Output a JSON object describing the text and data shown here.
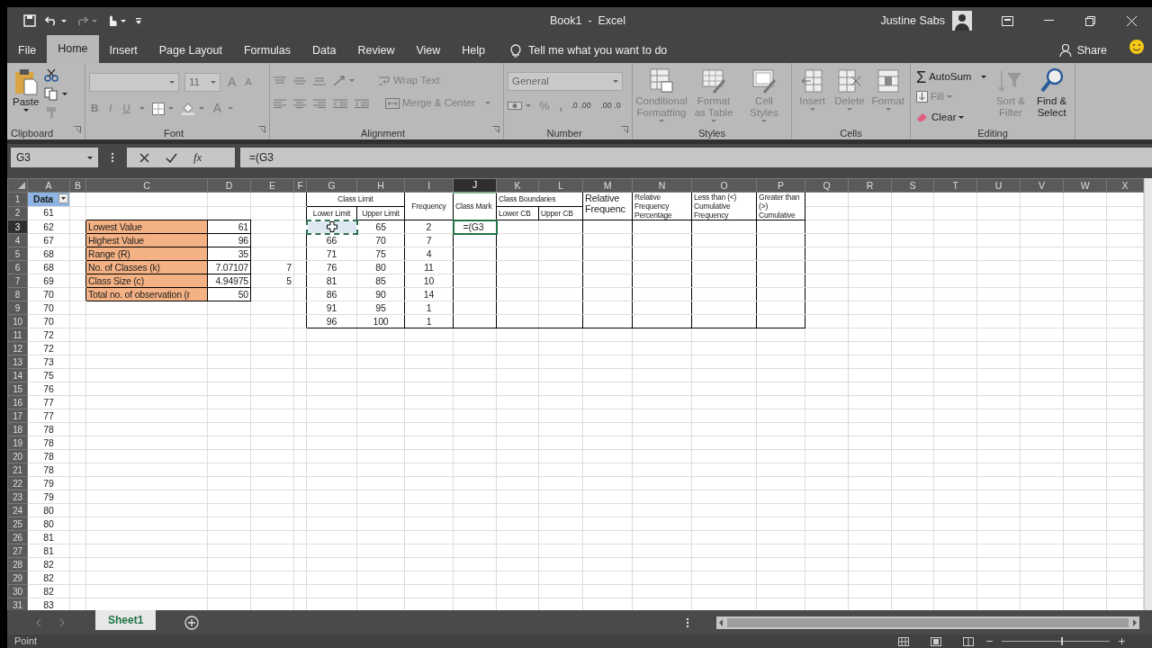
{
  "title_bar": {
    "title": "Book1  -  Excel",
    "user": "Justine Sabs"
  },
  "menu_tabs": [
    {
      "label": "File",
      "selected": false
    },
    {
      "label": "Home",
      "selected": true
    },
    {
      "label": "Insert",
      "selected": false
    },
    {
      "label": "Page Layout",
      "selected": false
    },
    {
      "label": "Formulas",
      "selected": false
    },
    {
      "label": "Data",
      "selected": false
    },
    {
      "label": "Review",
      "selected": false
    },
    {
      "label": "View",
      "selected": false
    },
    {
      "label": "Help",
      "selected": false
    }
  ],
  "tell_me": "Tell me what you want to do",
  "share": "Share",
  "ribbon": {
    "clipboard": {
      "label": "Clipboard",
      "paste": "Paste"
    },
    "font": {
      "label": "Font",
      "font_size": "11",
      "grow": "A",
      "shrink": "A",
      "bold": "B",
      "italic": "I",
      "underline": "U",
      "font_color_letter": "A"
    },
    "alignment": {
      "label": "Alignment",
      "wrap_text": {
        "label": "Wrap Text",
        "disabled": true
      },
      "merge_center": {
        "label": "Merge & Center",
        "disabled": true
      }
    },
    "number": {
      "label": "Number",
      "format": "General",
      "percent": "%",
      "comma": ",",
      "increase_decimal": ".0 .00",
      "decrease_decimal": ".00 .0"
    },
    "styles": {
      "label": "Styles",
      "buttons": [
        {
          "label": "Conditional Formatting",
          "disabled": true
        },
        {
          "label": "Format as Table",
          "disabled": true
        },
        {
          "label": "Cell Styles",
          "disabled": true
        }
      ]
    },
    "cells": {
      "label": "Cells",
      "buttons": [
        {
          "label": "Insert",
          "disabled": true
        },
        {
          "label": "Delete",
          "disabled": true
        },
        {
          "label": "Format",
          "disabled": true
        }
      ]
    },
    "editing": {
      "label": "Editing",
      "autosum": {
        "symbol": "Σ",
        "label": "AutoSum",
        "disabled": false
      },
      "fill": {
        "label": "Fill",
        "disabled": true
      },
      "clear": {
        "label": "Clear",
        "disabled": false
      },
      "sort_filter": {
        "label": "Sort & Filter",
        "disabled": true
      },
      "find_select": {
        "label": "Find & Select",
        "disabled": false
      }
    }
  },
  "formula_bar": {
    "name_box": "G3",
    "insert_function": "fx",
    "formula": "=(G3"
  },
  "columns": [
    {
      "letter": "A",
      "selected": false
    },
    {
      "letter": "B",
      "selected": false
    },
    {
      "letter": "C",
      "selected": false
    },
    {
      "letter": "D",
      "selected": false
    },
    {
      "letter": "E",
      "selected": false
    },
    {
      "letter": "F",
      "selected": false
    },
    {
      "letter": "G",
      "selected": false
    },
    {
      "letter": "H",
      "selected": false
    },
    {
      "letter": "I",
      "selected": false
    },
    {
      "letter": "J",
      "selected": true
    },
    {
      "letter": "K",
      "selected": false
    },
    {
      "letter": "L",
      "selected": false
    },
    {
      "letter": "M",
      "selected": false
    },
    {
      "letter": "N",
      "selected": false
    },
    {
      "letter": "O",
      "selected": false
    },
    {
      "letter": "P",
      "selected": false
    },
    {
      "letter": "Q",
      "selected": false
    },
    {
      "letter": "R",
      "selected": false
    },
    {
      "letter": "S",
      "selected": false
    },
    {
      "letter": "T",
      "selected": false
    },
    {
      "letter": "U",
      "selected": false
    },
    {
      "letter": "V",
      "selected": false
    },
    {
      "letter": "W",
      "selected": false
    },
    {
      "letter": "X",
      "selected": false
    }
  ],
  "rows": [
    {
      "number": "1",
      "selected": false,
      "cells": {
        "A": {
          "text": "Data",
          "kind": "filter"
        },
        "G": {
          "text": "Class Limit",
          "kind": "header"
        },
        "I": {
          "text": "Frequency",
          "kind": "header"
        },
        "J": {
          "text": "Class Mark",
          "kind": "header"
        },
        "K": {
          "text": "Class Boundaries",
          "kind": "header"
        },
        "M": {
          "text": "Relative Frequenc",
          "kind": "header_large"
        },
        "N": {
          "text": "Relative Frequency Percentage",
          "kind": "header"
        },
        "O": {
          "text": "Less than (<) Cumulative Frequency",
          "kind": "header"
        },
        "P": {
          "text": "Greater than (>) Cumulative",
          "kind": "header"
        }
      }
    },
    {
      "number": "2",
      "selected": false,
      "cells": {
        "A": "61",
        "G": {
          "text": "Lower Limit",
          "kind": "header"
        },
        "H": {
          "text": "Upper Limit",
          "kind": "header"
        },
        "K": {
          "text": "Lower CB",
          "kind": "header"
        },
        "L": {
          "text": "Upper CB",
          "kind": "header"
        }
      }
    },
    {
      "number": "3",
      "selected": true,
      "cells": {
        "A": "62",
        "C": {
          "text": "Lowest Value",
          "kind": "label"
        },
        "D": "61",
        "G": {
          "kind": "reference"
        },
        "H": "65",
        "I": "2",
        "J": {
          "text": "=(G3",
          "kind": "editing"
        }
      }
    },
    {
      "number": "4",
      "selected": false,
      "cells": {
        "A": "67",
        "C": {
          "text": "Highest Value",
          "kind": "label"
        },
        "D": "96",
        "G": "66",
        "H": "70",
        "I": "7"
      }
    },
    {
      "number": "5",
      "selected": false,
      "cells": {
        "A": "68",
        "C": {
          "text": "Range (R)",
          "kind": "label"
        },
        "D": "35",
        "G": "71",
        "H": "75",
        "I": "4"
      }
    },
    {
      "number": "6",
      "selected": false,
      "cells": {
        "A": "68",
        "C": {
          "text": "No. of Classes (k)",
          "kind": "label"
        },
        "D": "7.07107",
        "E": "7",
        "G": "76",
        "H": "80",
        "I": "11"
      }
    },
    {
      "number": "7",
      "selected": false,
      "cells": {
        "A": "69",
        "C": {
          "text": "Class Size (c)",
          "kind": "label"
        },
        "D": "4.94975",
        "E": "5",
        "G": "81",
        "H": "85",
        "I": "10"
      }
    },
    {
      "number": "8",
      "selected": false,
      "cells": {
        "A": "70",
        "C": {
          "text": "Total no. of observation (r",
          "kind": "label"
        },
        "D": "50",
        "G": "86",
        "H": "90",
        "I": "14"
      }
    },
    {
      "number": "9",
      "selected": false,
      "cells": {
        "A": "70",
        "G": "91",
        "H": "95",
        "I": "1"
      }
    },
    {
      "number": "10",
      "selected": false,
      "cells": {
        "A": "70",
        "G": "96",
        "H": "100",
        "I": "1"
      }
    },
    {
      "number": "11",
      "selected": false,
      "cells": {
        "A": "72"
      }
    },
    {
      "number": "12",
      "selected": false,
      "cells": {
        "A": "72"
      }
    },
    {
      "number": "13",
      "selected": false,
      "cells": {
        "A": "73"
      }
    },
    {
      "number": "14",
      "selected": false,
      "cells": {
        "A": "75"
      }
    },
    {
      "number": "15",
      "selected": false,
      "cells": {
        "A": "76"
      }
    },
    {
      "number": "16",
      "selected": false,
      "cells": {
        "A": "77"
      }
    },
    {
      "number": "17",
      "selected": false,
      "cells": {
        "A": "77"
      }
    },
    {
      "number": "18",
      "selected": false,
      "cells": {
        "A": "78"
      }
    },
    {
      "number": "19",
      "selected": false,
      "cells": {
        "A": "78"
      }
    },
    {
      "number": "20",
      "selected": false,
      "cells": {
        "A": "78"
      }
    },
    {
      "number": "21",
      "selected": false,
      "cells": {
        "A": "78"
      }
    },
    {
      "number": "22",
      "selected": false,
      "cells": {
        "A": "79"
      }
    },
    {
      "number": "23",
      "selected": false,
      "cells": {
        "A": "79"
      }
    },
    {
      "number": "24",
      "selected": false,
      "cells": {
        "A": "80"
      }
    },
    {
      "number": "25",
      "selected": false,
      "cells": {
        "A": "80"
      }
    },
    {
      "number": "26",
      "selected": false,
      "cells": {
        "A": "81"
      }
    },
    {
      "number": "27",
      "selected": false,
      "cells": {
        "A": "81"
      }
    },
    {
      "number": "28",
      "selected": false,
      "cells": {
        "A": "82"
      }
    },
    {
      "number": "29",
      "selected": false,
      "cells": {
        "A": "82"
      }
    },
    {
      "number": "30",
      "selected": false,
      "cells": {
        "A": "82"
      }
    },
    {
      "number": "31",
      "selected": false,
      "cells": {
        "A": "83"
      }
    }
  ],
  "sheet_tabs": [
    {
      "label": "Sheet1",
      "selected": true
    }
  ],
  "status_bar": {
    "mode": "Point",
    "zoom": {
      "level": 0.55
    }
  }
}
